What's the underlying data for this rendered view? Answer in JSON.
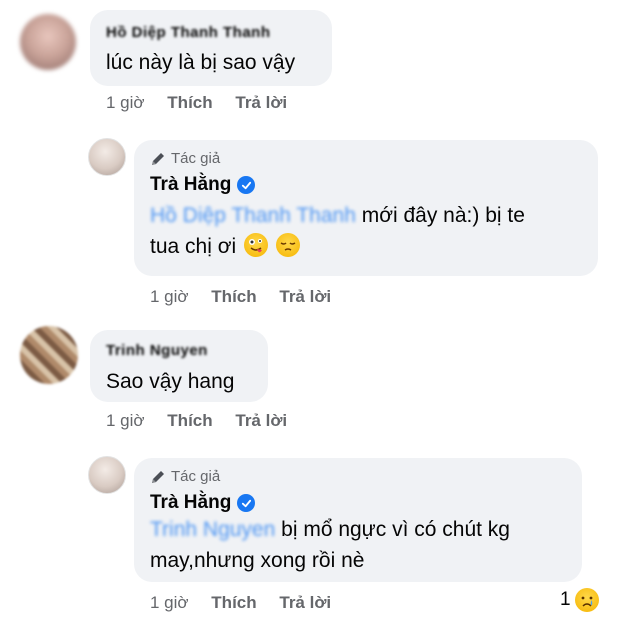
{
  "comments": [
    {
      "author": "Hồ Diệp Thanh Thanh",
      "text": "lúc này là bị sao vậy",
      "time": "1 giờ",
      "like_label": "Thích",
      "reply_label": "Trả lời"
    },
    {
      "author_badge": "Tác giả",
      "author": "Trà Hằng",
      "mention": "Hồ Diệp Thanh Thanh",
      "text_line1": "mới đây nà:) bị te",
      "text_line2": "tua chị ơi",
      "emojis": [
        "zany-face-emoji",
        "pensive-face-emoji"
      ],
      "time": "1 giờ",
      "like_label": "Thích",
      "reply_label": "Trả lời"
    },
    {
      "author": "Trinh Nguyen",
      "text": "Sao vậy hang",
      "time": "1 giờ",
      "like_label": "Thích",
      "reply_label": "Trả lời"
    },
    {
      "author_badge": "Tác giả",
      "author": "Trà Hằng",
      "mention": "Trinh Nguyen",
      "text_line1": "bị mổ ngực vì có chút kg",
      "text_line2": "may,nhưng xong rồi nè",
      "time": "1 giờ",
      "like_label": "Thích",
      "reply_label": "Trả lời",
      "reaction_count": "1",
      "reaction_icon": "crying-face-emoji"
    }
  ],
  "colors": {
    "bubble": "#f0f2f5",
    "meta": "#65676b",
    "link": "#1877f2",
    "verified": "#1877f2"
  }
}
